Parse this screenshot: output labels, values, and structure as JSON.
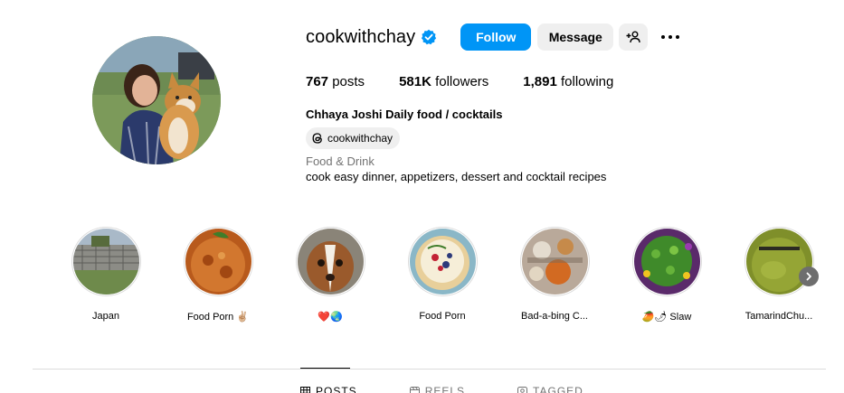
{
  "profile": {
    "username": "cookwithchay",
    "follow_label": "Follow",
    "message_label": "Message",
    "accent": "#0095f6"
  },
  "stats": {
    "posts_count": "767",
    "posts_label": "posts",
    "followers_count": "581K",
    "followers_label": "followers",
    "following_count": "1,891",
    "following_label": "following"
  },
  "bio": {
    "full_name": "Chhaya Joshi Daily food / cocktails",
    "threads_handle": "cookwithchay",
    "category": "Food & Drink",
    "text": "cook easy dinner, appetizers, dessert and cocktail recipes"
  },
  "highlights": [
    {
      "label": "Japan",
      "icon": "stone-wall-photo"
    },
    {
      "label": "Food Porn ✌🏼",
      "icon": "curry-photo"
    },
    {
      "label": "❤️🌏",
      "icon": "dog-photo"
    },
    {
      "label": "Food Porn",
      "icon": "berry-tart-photo"
    },
    {
      "label": "Bad-a-bing C...",
      "icon": "food-photo"
    },
    {
      "label": "🥭🌶 Slaw",
      "icon": "slaw-photo"
    },
    {
      "label": "TamarindChu...",
      "icon": "chutney-photo"
    }
  ],
  "tabs": [
    {
      "label": "POSTS",
      "icon": "grid-icon"
    },
    {
      "label": "REELS",
      "icon": "reels-icon"
    },
    {
      "label": "TAGGED",
      "icon": "tagged-icon"
    }
  ]
}
